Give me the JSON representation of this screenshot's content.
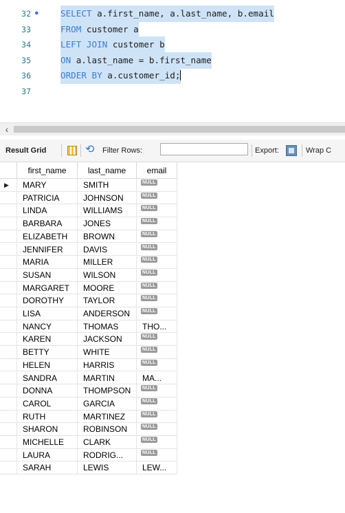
{
  "editor": {
    "lines": [
      {
        "number": "32",
        "marker": true,
        "selected": true,
        "parts": [
          {
            "kw": "SELECT"
          },
          {
            "t": " a.first_name, a.last_name, b.email"
          }
        ]
      },
      {
        "number": "33",
        "marker": false,
        "selected": true,
        "parts": [
          {
            "kw": "FROM"
          },
          {
            "t": " customer a"
          }
        ]
      },
      {
        "number": "34",
        "marker": false,
        "selected": true,
        "parts": [
          {
            "kw": "LEFT JOIN"
          },
          {
            "t": " customer b"
          }
        ]
      },
      {
        "number": "35",
        "marker": false,
        "selected": true,
        "parts": [
          {
            "kw": "ON"
          },
          {
            "t": " a.last_name = b.first_name"
          }
        ]
      },
      {
        "number": "36",
        "marker": false,
        "selected": true,
        "parts": [
          {
            "kw": "ORDER BY"
          },
          {
            "t": " a.customer_id;"
          }
        ]
      },
      {
        "number": "37",
        "marker": false,
        "selected": false,
        "parts": []
      }
    ]
  },
  "toolbar": {
    "result_grid_label": "Result Grid",
    "filter_rows_label": "Filter Rows:",
    "filter_value": "",
    "export_label": "Export:",
    "wrap_label": "Wrap C"
  },
  "grid": {
    "columns": [
      "first_name",
      "last_name",
      "email"
    ],
    "null_label": "NULL",
    "rows": [
      [
        "MARY",
        "SMITH",
        null
      ],
      [
        "PATRICIA",
        "JOHNSON",
        null
      ],
      [
        "LINDA",
        "WILLIAMS",
        null
      ],
      [
        "BARBARA",
        "JONES",
        null
      ],
      [
        "ELIZABETH",
        "BROWN",
        null
      ],
      [
        "JENNIFER",
        "DAVIS",
        null
      ],
      [
        "MARIA",
        "MILLER",
        null
      ],
      [
        "SUSAN",
        "WILSON",
        null
      ],
      [
        "MARGARET",
        "MOORE",
        null
      ],
      [
        "DOROTHY",
        "TAYLOR",
        null
      ],
      [
        "LISA",
        "ANDERSON",
        null
      ],
      [
        "NANCY",
        "THOMAS",
        "THO..."
      ],
      [
        "KAREN",
        "JACKSON",
        null
      ],
      [
        "BETTY",
        "WHITE",
        null
      ],
      [
        "HELEN",
        "HARRIS",
        null
      ],
      [
        "SANDRA",
        "MARTIN",
        "MA..."
      ],
      [
        "DONNA",
        "THOMPSON",
        null
      ],
      [
        "CAROL",
        "GARCIA",
        null
      ],
      [
        "RUTH",
        "MARTINEZ",
        null
      ],
      [
        "SHARON",
        "ROBINSON",
        null
      ],
      [
        "MICHELLE",
        "CLARK",
        null
      ],
      [
        "LAURA",
        "RODRIG...",
        null
      ],
      [
        "SARAH",
        "LEWIS",
        "LEW..."
      ]
    ]
  }
}
